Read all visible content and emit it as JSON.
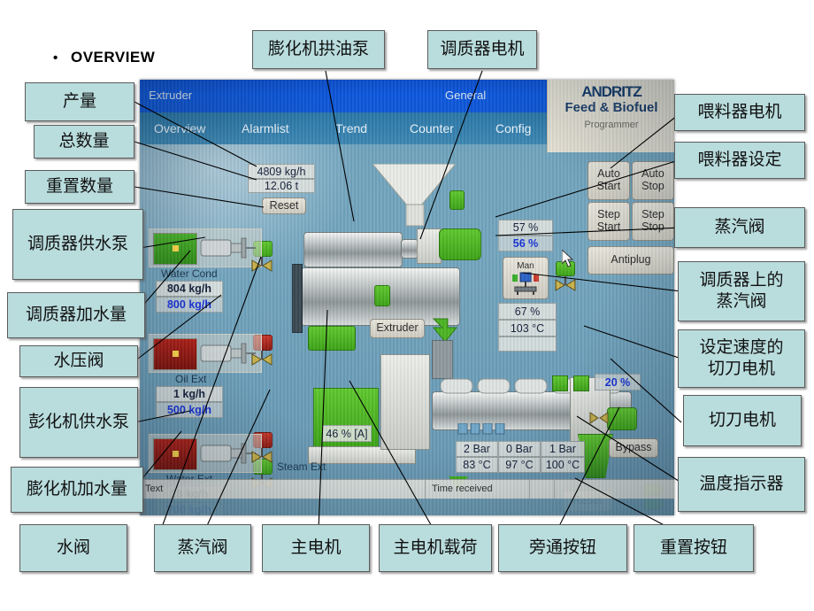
{
  "slide": {
    "bullet_marker": "•",
    "title": "OVERVIEW"
  },
  "callouts": {
    "left": [
      {
        "name": "output-rate",
        "label": "产量"
      },
      {
        "name": "total-quantity",
        "label": "总数量"
      },
      {
        "name": "reset-quantity",
        "label": "重置数量"
      },
      {
        "name": "conditioner-water-pump",
        "label": "调质器供水泵"
      },
      {
        "name": "conditioner-water-amount",
        "label": "调质器加水量"
      },
      {
        "name": "water-pressure-valve",
        "label": "水压阀"
      },
      {
        "name": "extruder-water-pump",
        "label": "彭化机供水泵"
      },
      {
        "name": "extruder-water-amount",
        "label": "膨化机加水量"
      }
    ],
    "top": [
      {
        "name": "extruder-oil-pump",
        "label": "膨化机拱油泵"
      },
      {
        "name": "conditioner-motor",
        "label": "调质器电机"
      }
    ],
    "right": [
      {
        "name": "feeder-motor",
        "label": "喂料器电机"
      },
      {
        "name": "feeder-setpoint",
        "label": "喂料器设定"
      },
      {
        "name": "steam-valve-right",
        "label": "蒸汽阀"
      },
      {
        "name": "conditioner-steam-valve",
        "label": "调质器上的\n蒸汽阀"
      },
      {
        "name": "cutter-motor-setspeed",
        "label": "设定速度的\n切刀电机"
      },
      {
        "name": "cutter-motor",
        "label": "切刀电机"
      },
      {
        "name": "temperature-indicator",
        "label": "温度指示器"
      }
    ],
    "bottom": [
      {
        "name": "water-valve",
        "label": "水阀"
      },
      {
        "name": "steam-valve-bottom",
        "label": "蒸汽阀"
      },
      {
        "name": "main-motor",
        "label": "主电机"
      },
      {
        "name": "main-motor-load",
        "label": "主电机载荷"
      },
      {
        "name": "bypass-button",
        "label": "旁通按钮"
      },
      {
        "name": "reset-button",
        "label": "重置按钮"
      }
    ]
  },
  "hmi": {
    "titlebar": {
      "left_title": "Extruder",
      "right_title": "General"
    },
    "tabs": [
      {
        "label": "Overview"
      },
      {
        "label": "Alarmlist"
      },
      {
        "label": "Trend"
      },
      {
        "label": "Counter"
      },
      {
        "label": "Config"
      }
    ],
    "logo": {
      "line1": "ANDRITZ",
      "line2": "Feed & Biofuel",
      "line3": "Programmer"
    },
    "counters": {
      "rate": "4809 kg/h",
      "total": "12.06 t",
      "reset_label": "Reset"
    },
    "pumps": [
      {
        "name": "water-cond",
        "label": "Water Cond",
        "actual": "804 kg/h",
        "setpoint": "800 kg/h",
        "state": "on"
      },
      {
        "name": "oil-ext",
        "label": "Oil Ext",
        "actual": "1 kg/h",
        "setpoint": "500 kg/h",
        "state": "off"
      },
      {
        "name": "water-ext",
        "label": "Water Ext",
        "actual": "18 kg/h",
        "setpoint": "700 kg/h",
        "state": "off"
      }
    ],
    "steam_ext_label": "Steam Ext",
    "feeder": {
      "actual": "57 %",
      "setpoint": "56 %"
    },
    "conditioner": {
      "valve_mode": "Man",
      "level": "67 %",
      "temperature": "103 °C"
    },
    "extruder": {
      "tag": "Extruder",
      "motor_load": "46 % [A]"
    },
    "cutter": {
      "speed": "20 %"
    },
    "barrel": {
      "pressures": [
        "2 Bar",
        "0 Bar",
        "1 Bar"
      ],
      "temperatures": [
        "83 °C",
        "97 °C",
        "100 °C"
      ]
    },
    "buttons": {
      "auto_start": "Auto\nStart",
      "auto_stop": "Auto\nStop",
      "step_start": "Step\nStart",
      "step_stop": "Step\nStop",
      "antiplug": "Antiplug",
      "bypass": "Bypass",
      "alarm_reset": "Reset"
    },
    "alarmbar": {
      "text_col": "Text",
      "time_col": "Time received"
    }
  },
  "colors": {
    "callout_fill": "#b9dcdd",
    "callout_border": "#5c5c5c",
    "hmi_blue": "#6fa3bd",
    "titlebar_blue": "#0c58e0",
    "running_green": "#3da418",
    "stopped_red": "#b01f16",
    "setpoint_blue": "#1732d8"
  }
}
